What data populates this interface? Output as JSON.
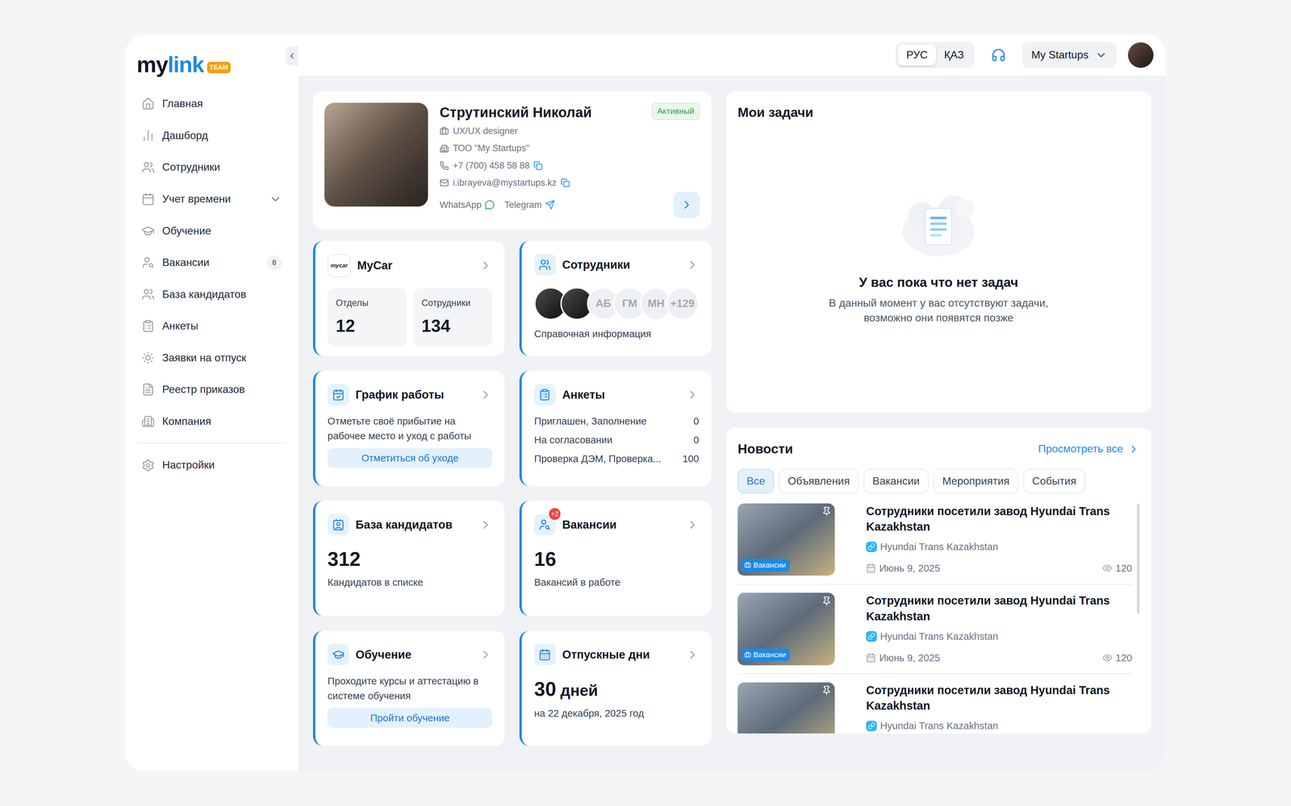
{
  "logo": {
    "text_dark": "my",
    "text_blue": "link",
    "badge": "TEAM"
  },
  "sidebar": {
    "items": [
      {
        "label": "Главная",
        "selected": false
      },
      {
        "label": "Дашборд",
        "selected": false
      },
      {
        "label": "Сотрудники",
        "selected": false
      },
      {
        "label": "Учет времени",
        "selected": false,
        "expanded": false
      },
      {
        "label": "Обучение",
        "selected": false
      },
      {
        "label": "Вакансии",
        "selected": false,
        "badge": "8"
      },
      {
        "label": "База кандидатов",
        "selected": false
      },
      {
        "label": "Анкеты",
        "selected": false
      },
      {
        "label": "Заявки на отпуск",
        "selected": false
      },
      {
        "label": "Реестр приказов",
        "selected": false
      },
      {
        "label": "Компания",
        "selected": false
      }
    ],
    "footer_items": [
      {
        "label": "Настройки",
        "selected": false
      }
    ]
  },
  "header": {
    "languages": [
      {
        "label": "РУС",
        "selected": true
      },
      {
        "label": "ҚАЗ",
        "selected": false
      }
    ],
    "company": "My Startups"
  },
  "profile": {
    "name": "Струтинский Николай",
    "status": "Активный",
    "role": "UX/UX designer",
    "company": "ТОО \"My Startups\"",
    "phone": "+7 (700) 458 58 88",
    "email": "i.ibrayeva@mystartups.kz",
    "messengers": [
      {
        "label": "WhatsApp",
        "color": "#25a244"
      },
      {
        "label": "Telegram",
        "color": "#2a9df4"
      }
    ]
  },
  "cards": [
    {
      "kind": "company",
      "title": "MyCar",
      "logo": "mycar",
      "stats": [
        {
          "label": "Отделы",
          "value": "12"
        },
        {
          "label": "Сотрудники",
          "value": "134"
        }
      ]
    },
    {
      "kind": "people",
      "title": "Сотрудники",
      "avatars": [
        {
          "kind": "photo"
        },
        {
          "kind": "photo"
        },
        {
          "kind": "initials",
          "text": "АБ"
        },
        {
          "kind": "initials",
          "text": "ГМ"
        },
        {
          "kind": "initials",
          "text": "МН"
        },
        {
          "kind": "initials",
          "text": "+129"
        }
      ],
      "caption": "Справочная информация"
    },
    {
      "kind": "action",
      "title": "График работы",
      "text": "Отметьте своё прибытие на рабочее место и уход с работы",
      "button": "Отметиться об уходе"
    },
    {
      "kind": "list",
      "title": "Анкеты",
      "rows": [
        {
          "label": "Приглашен, Заполнение",
          "value": "0"
        },
        {
          "label": "На согласовании",
          "value": "0"
        },
        {
          "label": "Проверка ДЭМ, Проверка...",
          "value": "100"
        }
      ]
    },
    {
      "kind": "count",
      "title": "База кандидатов",
      "value": "312",
      "caption": "Кандидатов в списке"
    },
    {
      "kind": "count",
      "title": "Вакансии",
      "value": "16",
      "caption": "Вакансий в работе",
      "badge": "+2"
    },
    {
      "kind": "action",
      "title": "Обучение",
      "text": "Проходите курсы и аттестацию в системе обучения",
      "button": "Пройти обучение"
    },
    {
      "kind": "days",
      "title": "Отпускные дни",
      "value": "30",
      "unit": "дней",
      "caption": "на 22 декабря, 2025 год"
    }
  ],
  "tasks": {
    "title": "Мои задачи",
    "empty_title": "У вас пока что нет задач",
    "empty_text": "В данный момент у вас отсутствуют задачи, возможно они появятся позже"
  },
  "news": {
    "title": "Новости",
    "view_all": "Просмотреть все",
    "filters": [
      {
        "label": "Все",
        "selected": true
      },
      {
        "label": "Объявления",
        "selected": false
      },
      {
        "label": "Вакансии",
        "selected": false
      },
      {
        "label": "Мероприятия",
        "selected": false
      },
      {
        "label": "События",
        "selected": false
      }
    ],
    "items": [
      {
        "title": "Сотрудники посетили завод Hyundai Trans Kazakhstan",
        "source": "Hyundai Trans Kazakhstan",
        "date": "Июнь 9, 2025",
        "views": "120",
        "tag": "Вакансии"
      },
      {
        "title": "Сотрудники посетили завод Hyundai Trans Kazakhstan",
        "source": "Hyundai Trans Kazakhstan",
        "date": "Июнь 9, 2025",
        "views": "120",
        "tag": "Вакансии"
      },
      {
        "title": "Сотрудники посетили завод Hyundai Trans Kazakhstan",
        "source": "Hyundai Trans Kazakhstan"
      }
    ]
  }
}
